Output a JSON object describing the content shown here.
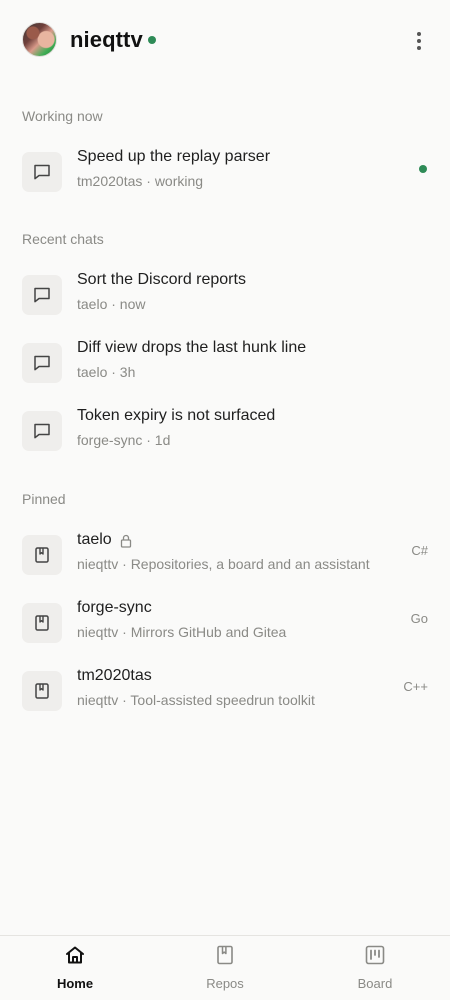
{
  "header": {
    "username": "nieqttv",
    "online_color": "#2e8b57",
    "avatar_icon": "user-avatar",
    "menu_icon": "more-vertical-icon"
  },
  "working_now": {
    "title": "Working now",
    "items": [
      {
        "title": "Speed up the replay parser",
        "subtitle": "tm2020tas · working",
        "icon": "chat-icon",
        "active": true
      }
    ]
  },
  "recent_chats": {
    "title": "Recent chats",
    "items": [
      {
        "title": "Sort the Discord reports",
        "subtitle": "taelo · now",
        "icon": "chat-icon"
      },
      {
        "title": "Diff view drops the last hunk line",
        "subtitle": "taelo · 3h",
        "icon": "chat-icon"
      },
      {
        "title": "Token expiry is not surfaced",
        "subtitle": "forge-sync · 1d",
        "icon": "chat-icon"
      }
    ]
  },
  "pinned": {
    "title": "Pinned",
    "items": [
      {
        "name": "taelo",
        "description": "nieqttv · Repositories, a board and an assistant",
        "language": "C#",
        "private": true,
        "icon": "repo-icon"
      },
      {
        "name": "forge-sync",
        "description": "nieqttv · Mirrors GitHub and Gitea",
        "language": "Go",
        "private": false,
        "icon": "repo-icon"
      },
      {
        "name": "tm2020tas",
        "description": "nieqttv · Tool-assisted speedrun toolkit",
        "language": "C++",
        "private": false,
        "icon": "repo-icon"
      }
    ]
  },
  "bottom_nav": {
    "items": [
      {
        "label": "Home",
        "icon": "home-icon",
        "active": true
      },
      {
        "label": "Repos",
        "icon": "repo-icon",
        "active": false
      },
      {
        "label": "Board",
        "icon": "board-icon",
        "active": false
      }
    ]
  },
  "colors": {
    "background": "#fafaf9",
    "accent_green": "#2e8b57",
    "muted_text": "#8a8a86",
    "tile_bg": "#efeeec"
  }
}
